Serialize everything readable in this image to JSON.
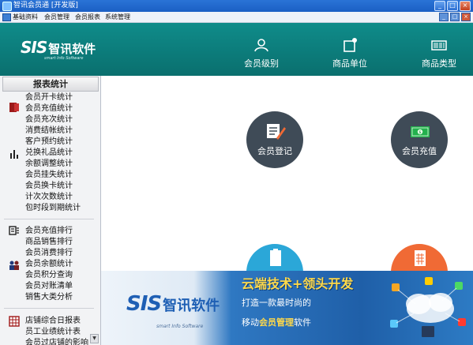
{
  "window": {
    "title": "智讯会员通 [开发版]",
    "controls": [
      "_",
      "□",
      "×"
    ]
  },
  "menubar": {
    "items": [
      "基础资料",
      "会员管理",
      "会员报表",
      "系统管理"
    ]
  },
  "header": {
    "logo_text": "SIS",
    "logo_cn": "智讯软件",
    "logo_sub": "smart Info Software",
    "nav": [
      {
        "label": "会员级别",
        "icon": "user-icon"
      },
      {
        "label": "商品单位",
        "icon": "tag-icon"
      },
      {
        "label": "商品类型",
        "icon": "barcode-icon"
      }
    ]
  },
  "sidebar": {
    "title": "报表统计",
    "group1": [
      "会员开卡统计",
      "会员充值统计",
      "会员充次统计",
      "消费结帐统计",
      "客户预约统计",
      "兑换礼品统计",
      "余额调整统计",
      "会员挂失统计",
      "会员换卡统计",
      "计次次数统计",
      "包时段到期统计"
    ],
    "group2": [
      "会员充值排行",
      "商品销售排行",
      "会员消费排行",
      "会员余额统计",
      "会员积分查询",
      "会员对账清单",
      "销售大类分析"
    ],
    "group3": [
      "店铺综合日报表",
      "员工业绩统计表",
      "会员过店铺的影响"
    ]
  },
  "main": {
    "tiles": [
      {
        "label": "会员登记",
        "icon": "register-icon",
        "color": "#3f4b57"
      },
      {
        "label": "会员充值",
        "icon": "money-icon",
        "color": "#3f4b57"
      }
    ]
  },
  "banner": {
    "logo_text": "SIS",
    "logo_cn": "智讯软件",
    "logo_sub": "smart Info Software",
    "slogan1": "云端技术+领头开发",
    "slogan2": "打造一款最时尚的",
    "slogan3_prefix": "移动",
    "slogan3_highlight": "会员管理",
    "slogan3_suffix": "软件"
  },
  "colors": {
    "header_teal": "#0f8c8a",
    "tile_dark": "#3f4b57",
    "tile_blue": "#2ba7d8",
    "tile_orange": "#f06a35",
    "banner_blue": "#1f5fa8",
    "accent_yellow": "#ffd94a"
  }
}
